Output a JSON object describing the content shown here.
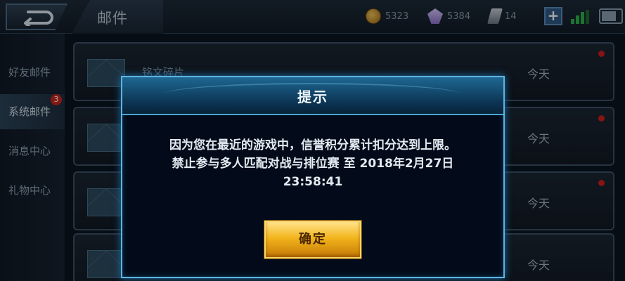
{
  "header": {
    "title": "邮件",
    "resources": {
      "coins": "5323",
      "gems": "5384",
      "tickets": "14"
    },
    "plus_label": "+"
  },
  "sidebar": {
    "items": [
      {
        "label": "好友邮件"
      },
      {
        "label": "系统邮件",
        "badge": "3"
      },
      {
        "label": "消息中心"
      },
      {
        "label": "礼物中心"
      }
    ]
  },
  "mails": [
    {
      "subject": "铭文碎片",
      "date": "今天",
      "unread": true
    },
    {
      "subject": "",
      "date": "今天",
      "unread": true
    },
    {
      "subject": "",
      "date": "今天",
      "unread": true
    },
    {
      "subject": "",
      "date": "今天",
      "unread": false
    }
  ],
  "dialog": {
    "title": "提示",
    "message_line1": "因为您在最近的游戏中，信誉积分累计扣分达到上限。",
    "message_line2": "禁止参与多人匹配对战与排位赛 至 2018年2月27日",
    "message_line3": "23:58:41",
    "ok_label": "确定"
  },
  "colors": {
    "dialog_border": "#5fb4de",
    "ok_button": "#f2b51d",
    "unread_dot": "#d01e1e",
    "badge": "#c8261d"
  }
}
